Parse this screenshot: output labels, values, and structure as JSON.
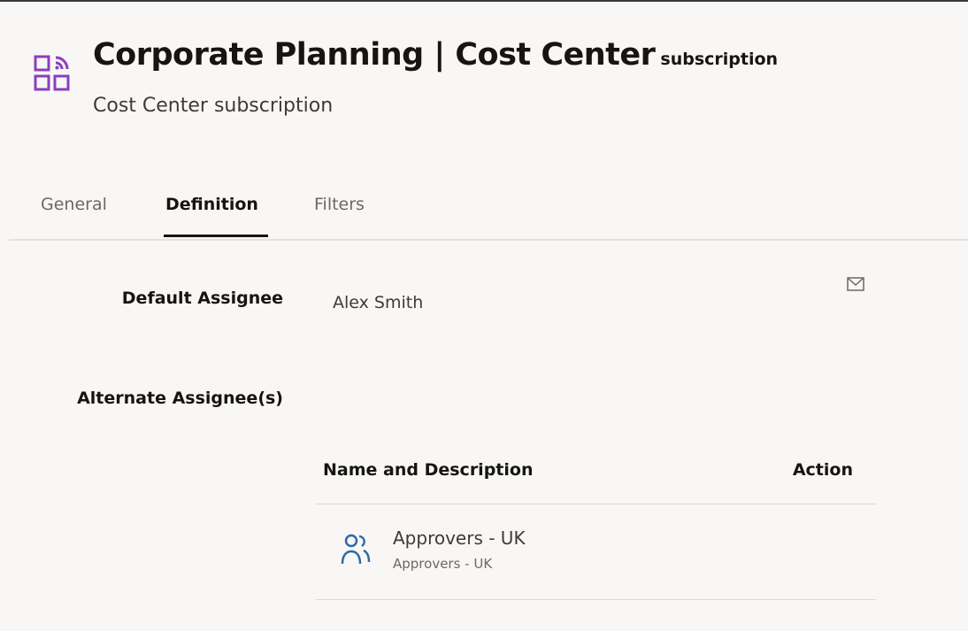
{
  "header": {
    "title": "Corporate Planning | Cost Center",
    "title_suffix": "subscription",
    "subtitle": "Cost Center subscription",
    "app_icon": "subscription-grid-icon",
    "accent_color": "#8a3fbf"
  },
  "tabs": [
    {
      "label": "General",
      "active": false
    },
    {
      "label": "Definition",
      "active": true
    },
    {
      "label": "Filters",
      "active": false
    }
  ],
  "form": {
    "default_assignee_label": "Default Assignee",
    "default_assignee_value": "Alex Smith",
    "mail_icon": "mail-icon",
    "alternate_assignees_label": "Alternate Assignee(s)"
  },
  "alternate_table": {
    "columns": [
      "Name and Description",
      "Action"
    ],
    "rows": [
      {
        "name": "Approvers - UK",
        "description": "Approvers - UK",
        "icon": "group-users-icon",
        "icon_color": "#2f6aa5"
      }
    ]
  }
}
